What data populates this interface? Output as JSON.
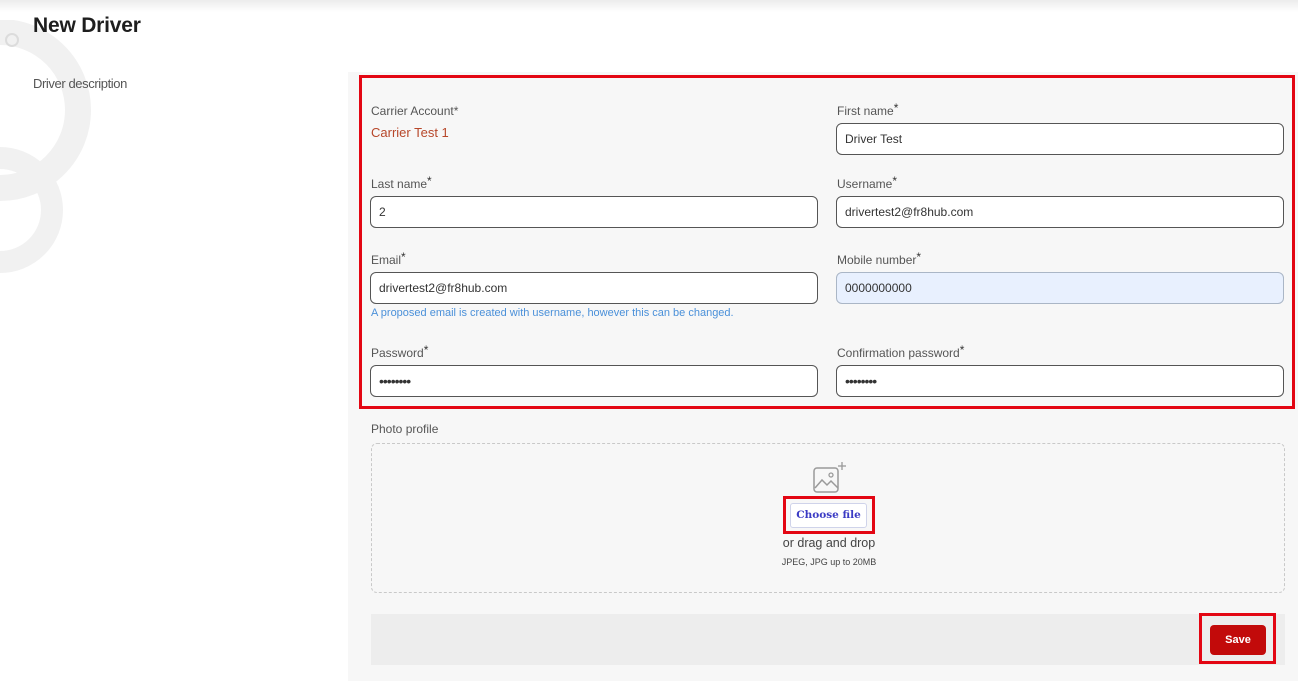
{
  "header": {
    "title": "New Driver"
  },
  "section": {
    "description": "Driver description"
  },
  "form": {
    "carrier_account": {
      "label": "Carrier Account*",
      "value": "Carrier Test 1"
    },
    "first_name": {
      "label": "First name",
      "required_mark": "*",
      "value": "Driver Test"
    },
    "last_name": {
      "label": "Last name",
      "required_mark": "*",
      "value": "2"
    },
    "username": {
      "label": "Username",
      "required_mark": "*",
      "value": "drivertest2@fr8hub.com"
    },
    "email": {
      "label": "Email",
      "required_mark": "*",
      "value": "drivertest2@fr8hub.com",
      "hint": "A proposed email is created with username, however this can be changed."
    },
    "mobile_number": {
      "label": "Mobile number",
      "required_mark": "*",
      "value": "0000000000"
    },
    "password": {
      "label": "Password",
      "required_mark": "*",
      "value": "••••••••"
    },
    "confirmation_password": {
      "label": "Confirmation password",
      "required_mark": "*",
      "value": "••••••••"
    }
  },
  "photo": {
    "label": "Photo profile",
    "icon": "image-add-icon",
    "choose_label": "Choose file",
    "drag_text": "or drag and drop",
    "file_types": "JPEG, JPG up to 20MB"
  },
  "actions": {
    "save_label": "Save"
  },
  "colors": {
    "highlight": "#e30613",
    "save": "#c20a0a",
    "carrier_value": "#b7472a",
    "hint": "#4a90d9",
    "autofill": "#e8f0fe"
  }
}
